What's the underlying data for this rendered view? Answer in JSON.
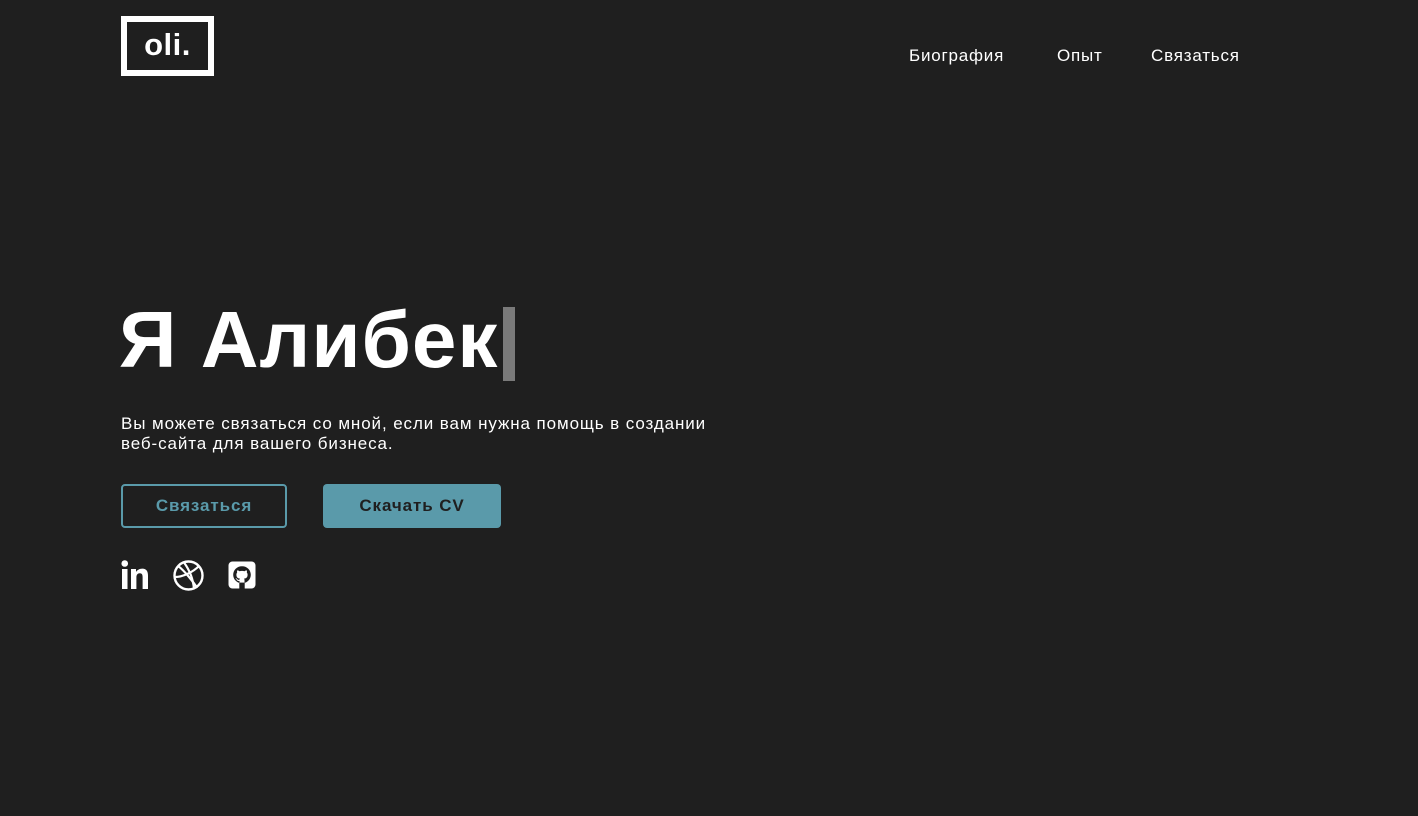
{
  "header": {
    "logo_text": "oli.",
    "nav": [
      {
        "label": "Биография"
      },
      {
        "label": "Опыт"
      },
      {
        "label": "Связаться"
      }
    ]
  },
  "hero": {
    "title": "Я Алибек",
    "subtitle_line1": "Вы можете связаться со мной, если вам нужна помощь в создании",
    "subtitle_line2": "веб-сайта для вашего бизнеса.",
    "contact_button": "Связаться",
    "cv_button": "Скачать CV"
  },
  "socials": [
    {
      "icon": "linkedin-icon"
    },
    {
      "icon": "dribbble-icon"
    },
    {
      "icon": "github-icon"
    }
  ],
  "colors": {
    "background": "#1f1f1f",
    "accent": "#5a9aaa",
    "text": "#ffffff",
    "cursor": "#7a7a7a"
  }
}
